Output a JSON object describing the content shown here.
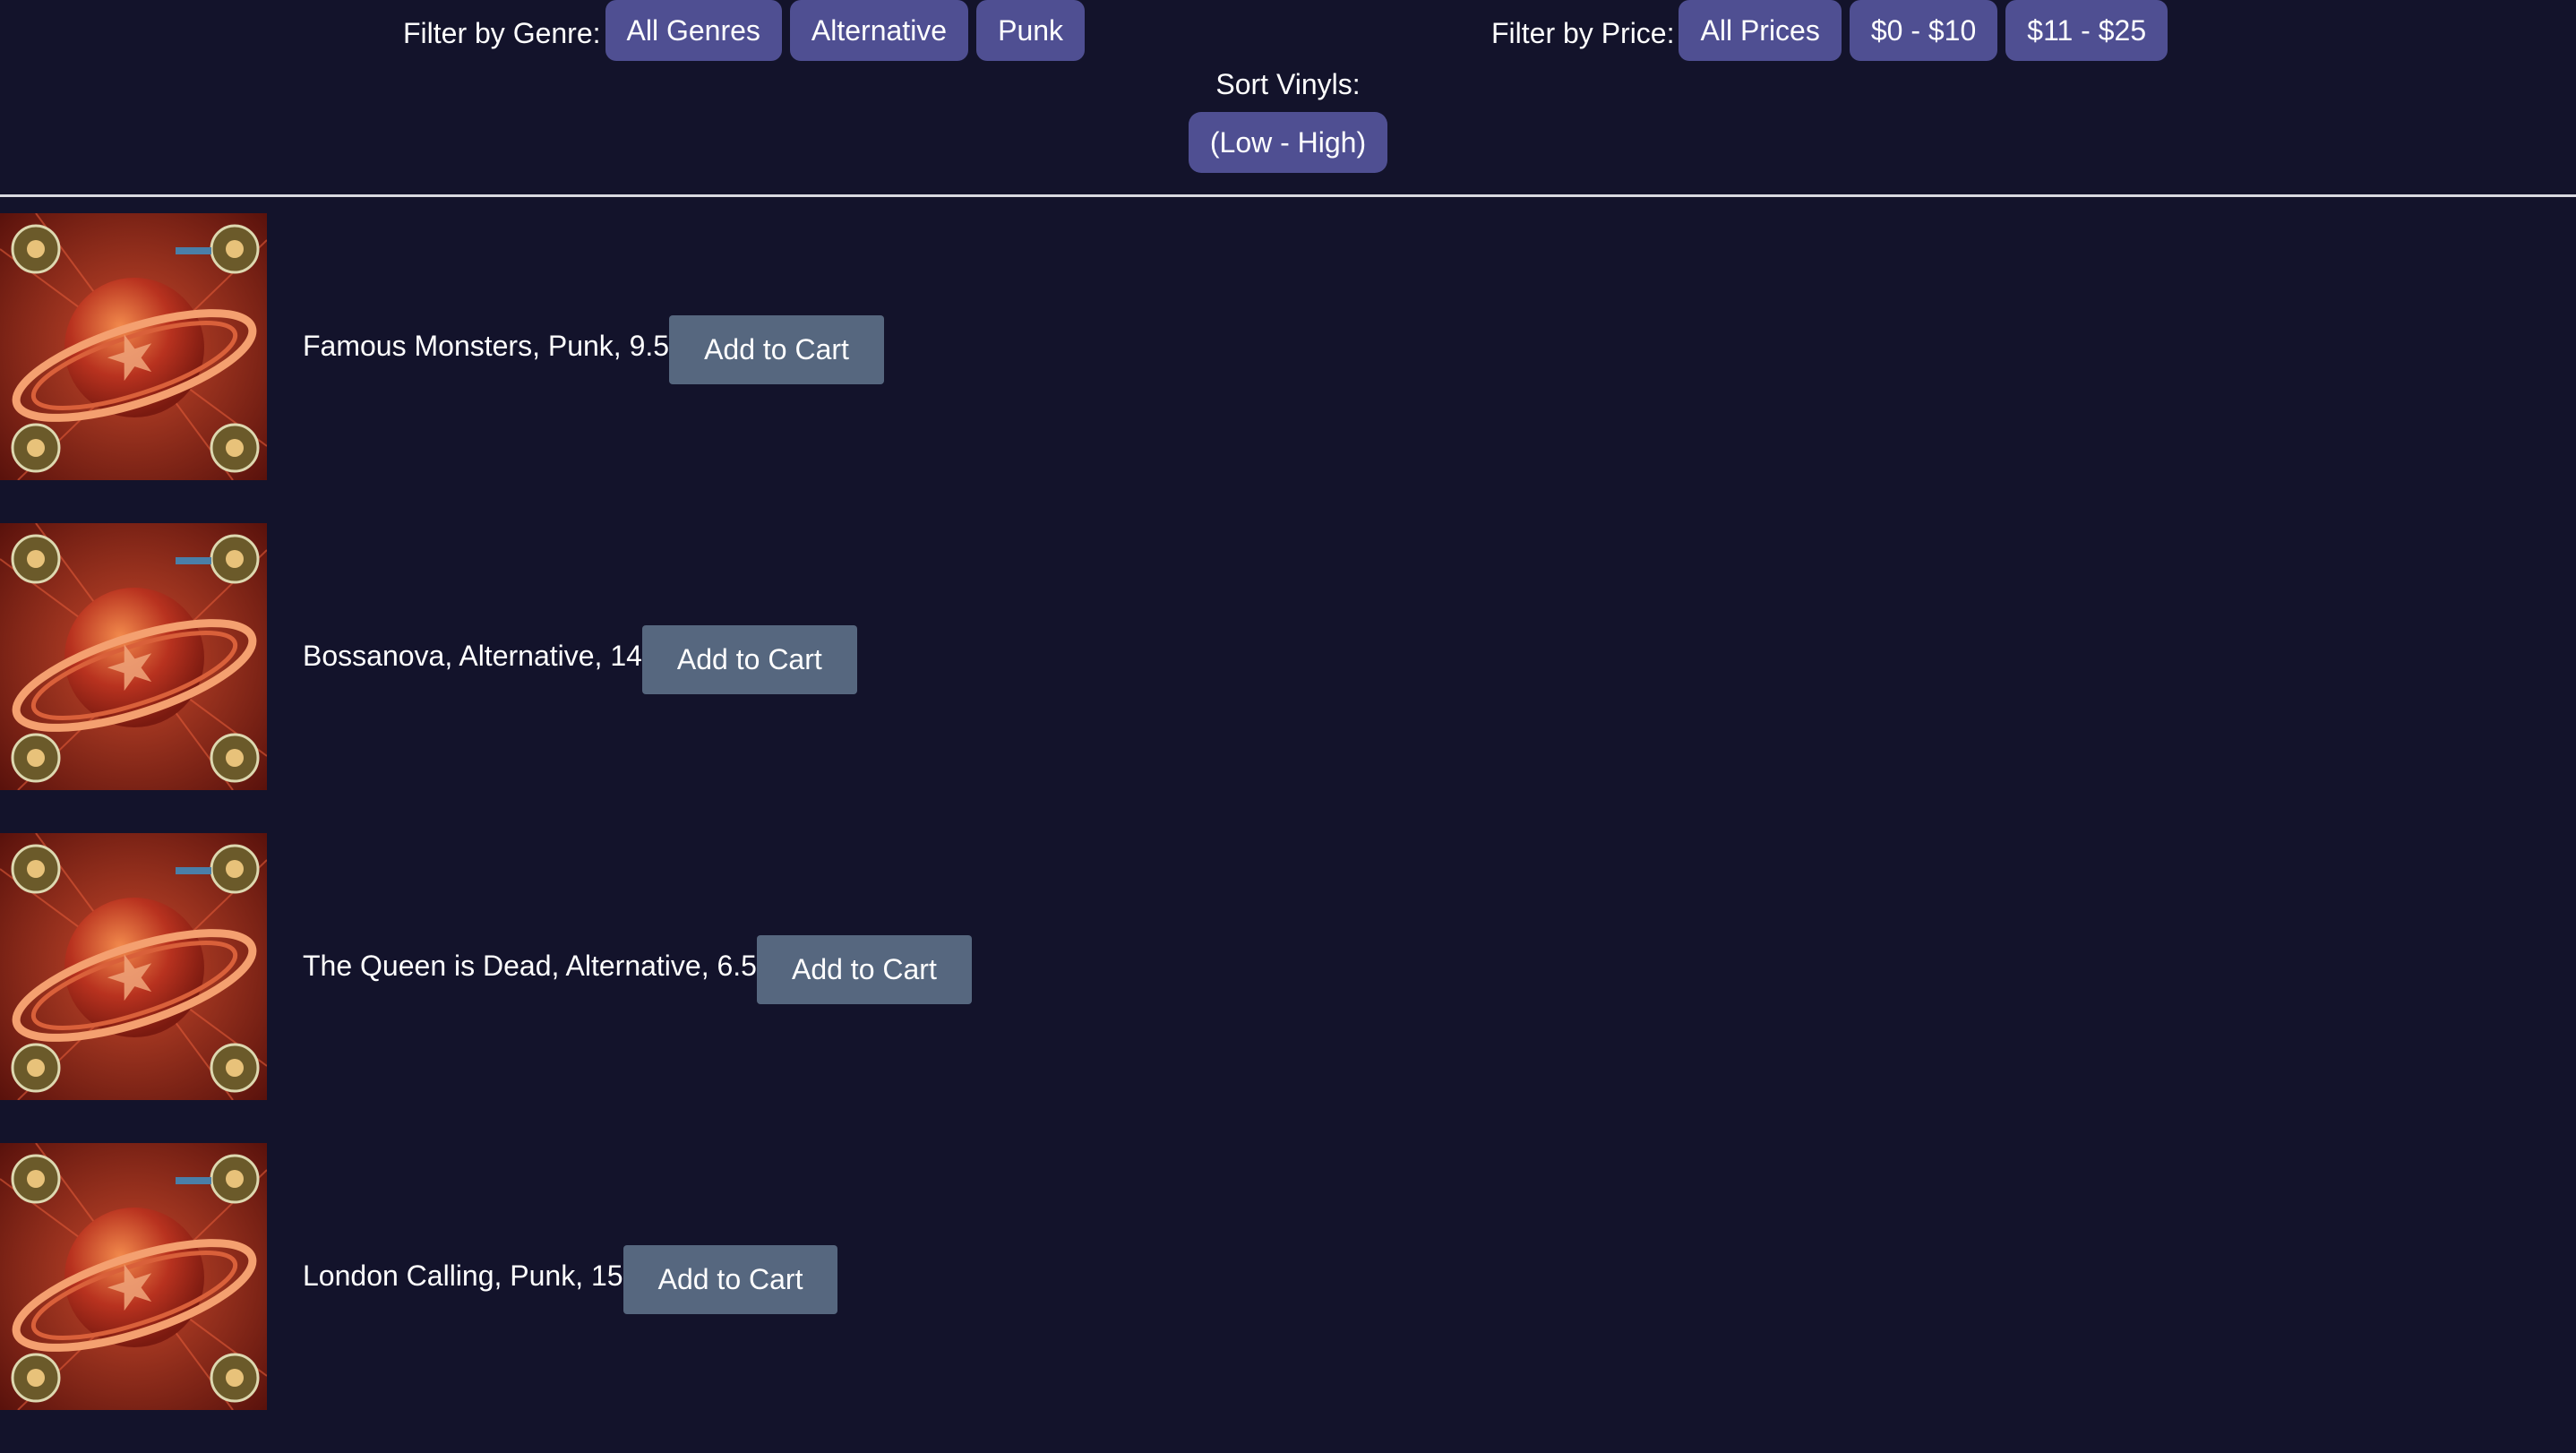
{
  "filters": {
    "genre": {
      "label": "Filter by Genre:",
      "options": [
        "All Genres",
        "Alternative",
        "Punk"
      ]
    },
    "price": {
      "label": "Filter by Price:",
      "options": [
        "All Prices",
        "$0 - $10",
        "$11 - $25"
      ]
    }
  },
  "sort": {
    "label": "Sort Vinyls:",
    "button_label": "(Low - High)"
  },
  "vinyls": [
    {
      "text": "Famous Monsters, Punk, 9.5",
      "button_label": "Add to Cart"
    },
    {
      "text": "Bossanova, Alternative, 14",
      "button_label": "Add to Cart"
    },
    {
      "text": "The Queen is Dead, Alternative, 6.5",
      "button_label": "Add to Cart"
    },
    {
      "text": "London Calling, Punk, 15",
      "button_label": "Add to Cart"
    }
  ],
  "colors": {
    "background": "#13132b",
    "pill": "#4f4f92",
    "cart_button": "#56677f",
    "divider": "#d8d8e0",
    "cover_red": "#b8321f",
    "cover_dark": "#5a120c"
  },
  "cover_image_icon": "album-cover-image"
}
